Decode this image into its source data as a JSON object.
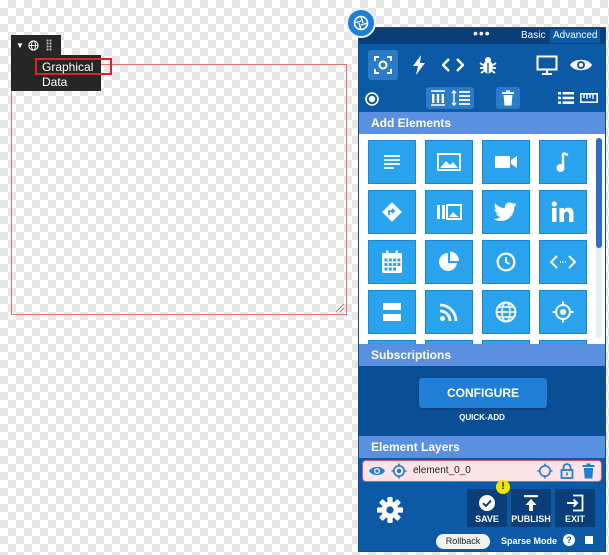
{
  "canvas_element": {
    "label_line1": "Graphical",
    "label_line2": "Data"
  },
  "panel": {
    "modes": {
      "dots": "•••",
      "basic": "Basic",
      "advanced": "Advanced"
    },
    "top_icons": [
      "target-icon",
      "bolt-icon",
      "code-icon",
      "bug-icon",
      "monitor-icon",
      "eye-icon"
    ],
    "tool_icons": [
      "radio-icon",
      "columns-icon",
      "list-indent-icon",
      "trash-icon",
      "list-icon",
      "ruler-icon"
    ],
    "add_elements_title": "Add Elements",
    "element_tiles": [
      "text-icon",
      "image-icon",
      "video-icon",
      "music-icon",
      "direction-icon",
      "gallery-icon",
      "twitter-icon",
      "linkedin-icon",
      "calendar-icon",
      "pie-chart-icon",
      "clock-icon",
      "embed-code-icon",
      "divider-icon",
      "rss-icon",
      "globe-icon",
      "crosshair-icon"
    ],
    "subscriptions_title": "Subscriptions",
    "configure_label": "CONFIGURE",
    "quick_add_label": "QUICK-ADD",
    "element_layers_title": "Element Layers",
    "layer": {
      "name": "element_0_0"
    },
    "buttons": {
      "save": "SAVE",
      "publish": "PUBLISH",
      "exit": "EXIT"
    },
    "warning_badge": "!",
    "rollback_label": "Rollback",
    "sparse_mode_label": "Sparse Mode",
    "sparse_help": "?"
  },
  "colors": {
    "panel_blue": "#0c5aa6",
    "tile_blue": "#29a3ee",
    "section_blue": "#5b8fe0",
    "selection_red": "#e0202a"
  }
}
